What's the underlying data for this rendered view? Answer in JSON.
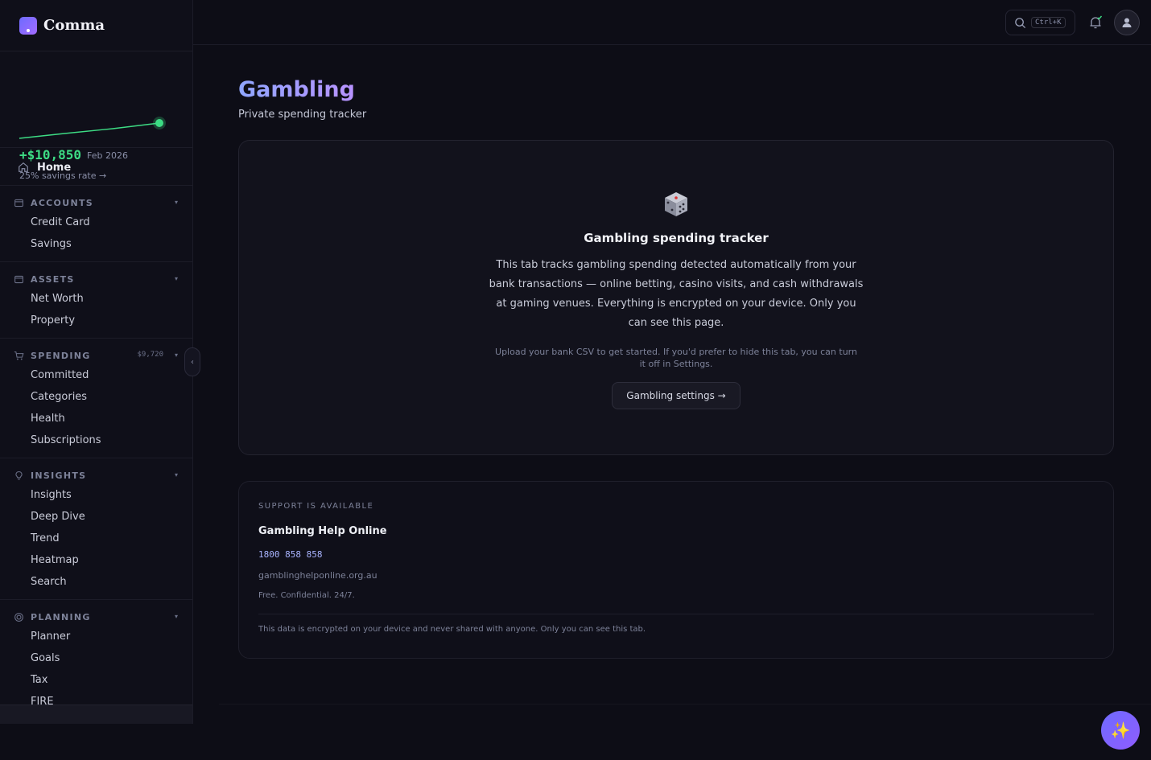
{
  "brand": {
    "name": "Comma"
  },
  "spark": {
    "amount": "+$10,850",
    "date": "Feb 2026",
    "rate": "25% savings rate →",
    "color": "#3ddc84"
  },
  "nav": {
    "home": "Home",
    "sections": [
      {
        "title": "ACCOUNTS",
        "icon": "wallet-icon",
        "items": [
          "Credit Card",
          "Savings"
        ]
      },
      {
        "title": "ASSETS",
        "icon": "wallet-icon",
        "items": [
          "Net Worth",
          "Property"
        ]
      },
      {
        "title": "SPENDING",
        "icon": "cart-icon",
        "amount": "$9,720",
        "items": [
          "Committed",
          "Categories",
          "Health",
          "Subscriptions"
        ]
      },
      {
        "title": "INSIGHTS",
        "icon": "lightbulb-icon",
        "items": [
          "Insights",
          "Deep Dive",
          "Trend",
          "Heatmap",
          "Search"
        ]
      },
      {
        "title": "PLANNING",
        "icon": "target-icon",
        "items": [
          "Planner",
          "Goals",
          "Tax",
          "FIRE"
        ]
      }
    ]
  },
  "topbar": {
    "search_shortcut": "Ctrl+K"
  },
  "page": {
    "title": "Gambling",
    "subtitle": "Private spending tracker"
  },
  "hero": {
    "title": "Gambling spending tracker",
    "body": "This tab tracks gambling spending detected automatically from your bank transactions — online betting, casino visits, and cash withdrawals at gaming venues. Everything is encrypted on your device. Only you can see this page.",
    "note": "Upload your bank CSV to get started. If you'd prefer to hide this tab, you can turn it off in Settings.",
    "button": "Gambling settings →"
  },
  "support": {
    "kicker": "SUPPORT IS AVAILABLE",
    "name": "Gambling Help Online",
    "phone": "1800 858 858",
    "site": "gamblinghelponline.org.au",
    "free": "Free. Confidential. 24/7.",
    "footer": "This data is encrypted on your device and never shared with anyone. Only you can see this tab."
  },
  "colors": {
    "accent": "#7b6bff",
    "positive": "#3ddc84"
  }
}
